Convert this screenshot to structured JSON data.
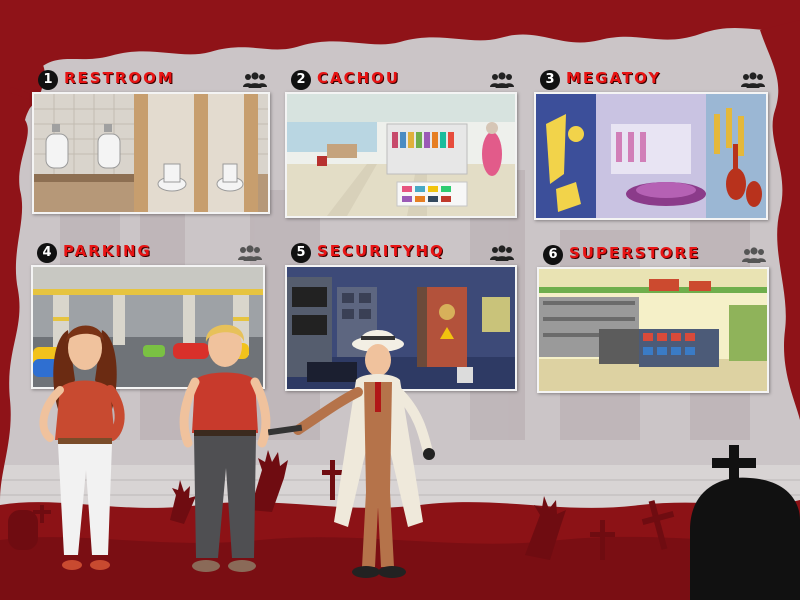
{
  "locations": [
    {
      "number": "1",
      "title": "RESTROOM",
      "group_icon": "people-group-icon"
    },
    {
      "number": "2",
      "title": "CACHOU",
      "group_icon": "people-group-icon"
    },
    {
      "number": "3",
      "title": "MEGATOY",
      "group_icon": "people-group-icon"
    },
    {
      "number": "4",
      "title": "PARKING",
      "group_icon": "people-group-icon"
    },
    {
      "number": "5",
      "title": "SECURITYHQ",
      "group_icon": "people-group-icon"
    },
    {
      "number": "6",
      "title": "SUPERSTORE",
      "group_icon": "people-group-icon"
    }
  ],
  "colors": {
    "title_red": "#e81414",
    "frame_red": "#8f1318",
    "background_gray": "#c9c4c6"
  },
  "characters": [
    "woman-character",
    "man-character",
    "detective-character"
  ]
}
